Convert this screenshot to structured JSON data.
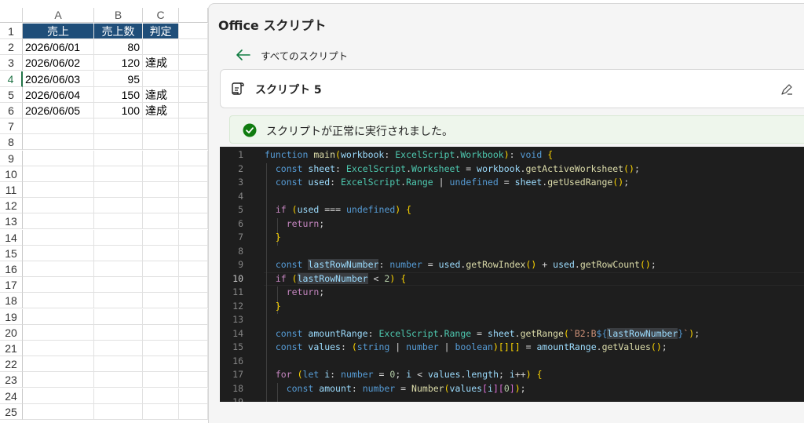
{
  "sheet": {
    "columns": [
      "A",
      "B",
      "C"
    ],
    "header": {
      "date": "売上",
      "qty": "売上数",
      "status": "判定"
    },
    "rows": [
      {
        "num": "1"
      },
      {
        "num": "2",
        "date": "2026/06/01",
        "qty": "80",
        "status": ""
      },
      {
        "num": "3",
        "date": "2026/06/02",
        "qty": "120",
        "status": "達成"
      },
      {
        "num": "4",
        "date": "2026/06/03",
        "qty": "95",
        "status": ""
      },
      {
        "num": "5",
        "date": "2026/06/04",
        "qty": "150",
        "status": "達成"
      },
      {
        "num": "6",
        "date": "2026/06/05",
        "qty": "100",
        "status": "達成"
      },
      {
        "num": "7"
      },
      {
        "num": "8"
      },
      {
        "num": "9"
      },
      {
        "num": "10"
      },
      {
        "num": "11"
      },
      {
        "num": "12"
      },
      {
        "num": "13"
      },
      {
        "num": "14"
      },
      {
        "num": "15"
      },
      {
        "num": "16"
      },
      {
        "num": "17"
      },
      {
        "num": "18"
      },
      {
        "num": "19"
      },
      {
        "num": "20"
      },
      {
        "num": "21"
      },
      {
        "num": "22"
      },
      {
        "num": "23"
      },
      {
        "num": "24"
      },
      {
        "num": "25"
      }
    ],
    "selected_row": "4",
    "header_fill_color": "#1f4e79"
  },
  "pane": {
    "title": "Office スクリプト",
    "back_label": "すべてのスクリプト",
    "script_name": "スクリプト 5",
    "status_text": "スクリプトが正常に実行されました。",
    "status_color": "#107c10"
  },
  "editor": {
    "current_line": "10",
    "line_numbers": [
      "1",
      "2",
      "3",
      "4",
      "5",
      "6",
      "7",
      "8",
      "9",
      "10",
      "11",
      "12",
      "13",
      "14",
      "15",
      "16",
      "17",
      "18",
      "19"
    ],
    "lines": [
      "function main(workbook: ExcelScript.Workbook): void {",
      "  const sheet: ExcelScript.Worksheet = workbook.getActiveWorksheet();",
      "  const used: ExcelScript.Range | undefined = sheet.getUsedRange();",
      "",
      "  if (used === undefined) {",
      "    return;",
      "  }",
      "",
      "  const lastRowNumber: number = used.getRowIndex() + used.getRowCount();",
      "  if (lastRowNumber < 2) {",
      "    return;",
      "  }",
      "",
      "  const amountRange: ExcelScript.Range = sheet.getRange(`B2:B${lastRowNumber}`);",
      "  const values: (string | number | boolean)[][] = amountRange.getValues();",
      "",
      "  for (let i: number = 0; i < values.length; i++) {",
      "    const amount: number = Number(values[i][0]);",
      ""
    ]
  }
}
